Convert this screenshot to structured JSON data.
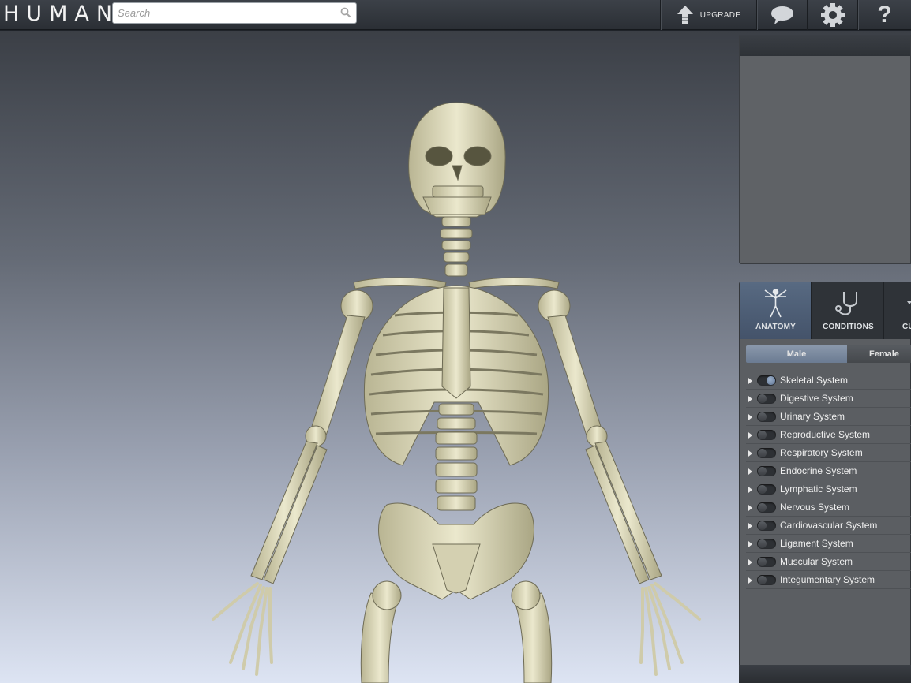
{
  "app": {
    "logo": "HUMAN"
  },
  "search": {
    "placeholder": "Search"
  },
  "toolbar": {
    "upgrade_label": "UPGRADE",
    "help_glyph": "?"
  },
  "tabs": [
    {
      "label": "ANATOMY",
      "icon": "human-figure-icon",
      "active": true
    },
    {
      "label": "CONDITIONS",
      "icon": "stethoscope-icon",
      "active": false
    },
    {
      "label": "CU",
      "icon": "curriculum-icon",
      "active": false
    }
  ],
  "gender": {
    "male": "Male",
    "female": "Female",
    "selected": "Male"
  },
  "systems": [
    {
      "label": "Skeletal System",
      "on": true
    },
    {
      "label": "Digestive System",
      "on": false
    },
    {
      "label": "Urinary System",
      "on": false
    },
    {
      "label": "Reproductive System",
      "on": false
    },
    {
      "label": "Respiratory System",
      "on": false
    },
    {
      "label": "Endocrine System",
      "on": false
    },
    {
      "label": "Lymphatic System",
      "on": false
    },
    {
      "label": "Nervous System",
      "on": false
    },
    {
      "label": "Cardiovascular System",
      "on": false
    },
    {
      "label": "Ligament System",
      "on": false
    },
    {
      "label": "Muscular System",
      "on": false
    },
    {
      "label": "Integumentary System",
      "on": false
    }
  ],
  "colors": {
    "bone": "#ddd9bb",
    "active_tab": "#586a82",
    "toggle_on": "#6f86a8"
  }
}
